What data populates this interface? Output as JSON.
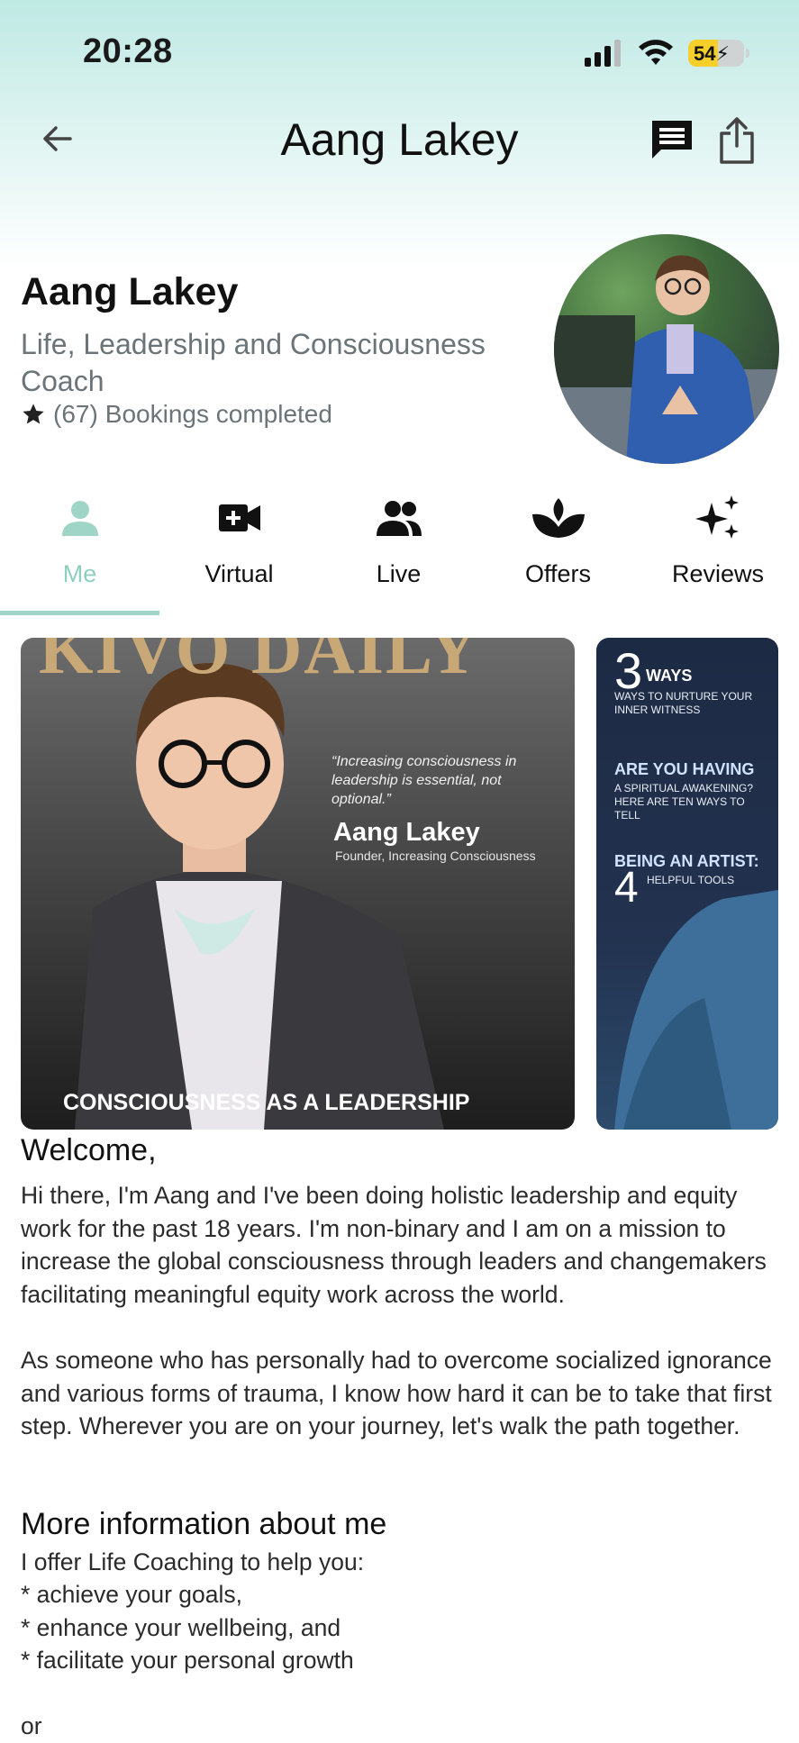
{
  "status_bar": {
    "time": "20:28",
    "battery_level": "54",
    "battery_fraction": 0.54
  },
  "nav": {
    "title": "Aang Lakey"
  },
  "profile": {
    "name": "Aang Lakey",
    "title": "Life, Leadership and Consciousness Coach",
    "bookings_count": "(67)",
    "bookings_label": "Bookings completed"
  },
  "tabs": [
    {
      "label": "Me",
      "icon": "person-icon",
      "active": true
    },
    {
      "label": "Virtual",
      "icon": "video-add-icon",
      "active": false
    },
    {
      "label": "Live",
      "icon": "group-icon",
      "active": false
    },
    {
      "label": "Offers",
      "icon": "lotus-icon",
      "active": false
    },
    {
      "label": "Reviews",
      "icon": "sparkles-icon",
      "active": false
    }
  ],
  "carousel": {
    "card1": {
      "magazine": "KIVO DAILY",
      "quote": "“Increasing consciousness in leadership is essential, not optional.”",
      "name": "Aang Lakey",
      "role": "Founder, Increasing Consciousness",
      "banner": "CONSCIOUSNESS AS A LEADERSHIP"
    },
    "card2": {
      "h1_num": "3",
      "h1": "WAYS",
      "s1": "WAYS TO NURTURE YOUR INNER WITNESS",
      "h2": "ARE YOU HAVING",
      "s2": "A SPIRITUAL AWAKENING? HERE ARE TEN WAYS TO TELL",
      "h3": "BEING AN ARTIST:",
      "h3_num": "4",
      "s3": "HELPFUL TOOLS"
    }
  },
  "welcome": {
    "heading": "Welcome,",
    "p1": "Hi there, I'm Aang and I've been doing holistic leadership and equity work for the past 18 years. I'm non-binary and I am on a mission to increase the global consciousness through leaders and changemakers facilitating meaningful equity work across the world.",
    "p2": "As someone who has personally had to overcome socialized ignorance and various forms of trauma, I know how hard it can be to take that first step. Wherever you are on your journey, let's walk the path together."
  },
  "more_info": {
    "heading": "More information about me",
    "lines": [
      "I offer Life Coaching to help you:",
      "* achieve your goals,",
      "* enhance your wellbeing, and",
      "* facilitate your personal growth",
      "or"
    ]
  },
  "colors": {
    "accent": "#8fcfbd",
    "header_gradient_top": "#bfe9e4",
    "battery": "#f6cf2a",
    "muted_text": "#6b7479"
  }
}
